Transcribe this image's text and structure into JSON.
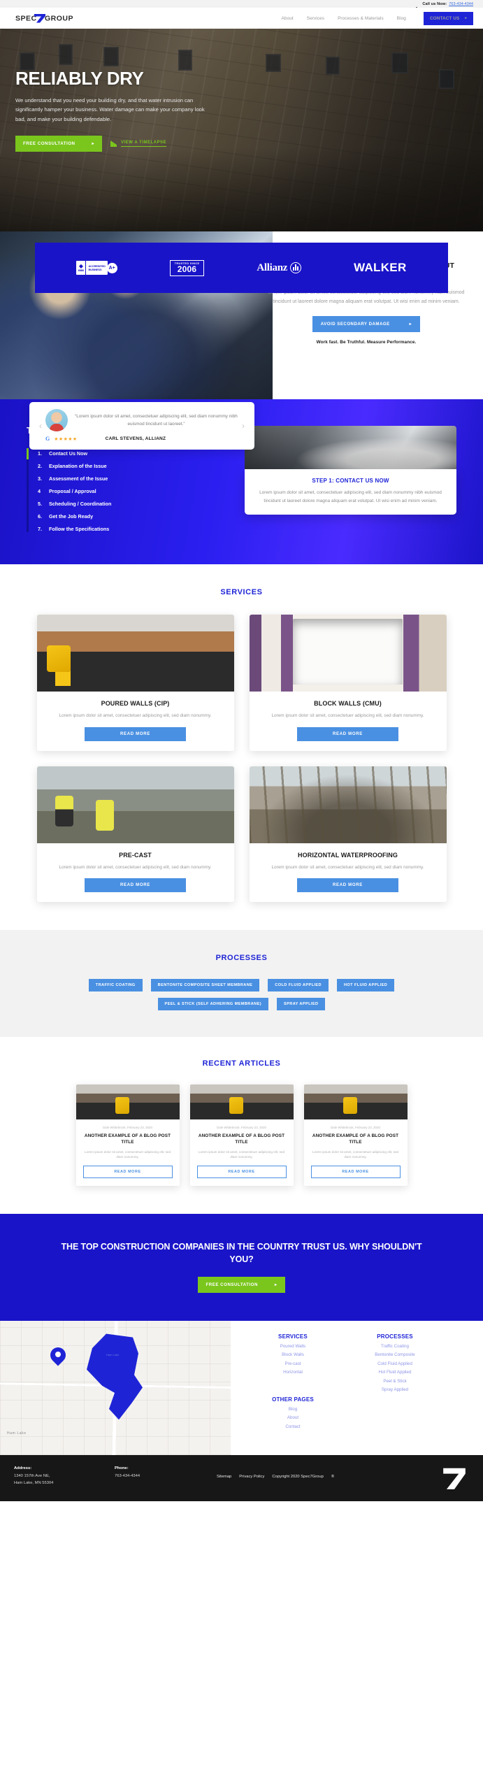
{
  "topbar": {
    "call_label": "Call us Now:",
    "phone": "763-434-4344",
    "phone_icon": "phone-icon"
  },
  "nav": {
    "logo_text": "SPEC7GROUP",
    "links": [
      {
        "label": "About"
      },
      {
        "label": "Services"
      },
      {
        "label": "Processes & Materials"
      },
      {
        "label": "Blog"
      }
    ],
    "contact_label": "CONTACT US",
    "contact_caret": "▸"
  },
  "hero": {
    "title": "RELIABLY DRY",
    "body": "We understand that you need your building dry, and that water intrusion can significantly hamper your business. Water damage can make your company look bad, and make your building defendable.",
    "primary_cta": "FREE CONSULTATION",
    "primary_caret": "▸",
    "secondary_cta": "VIEW A TIMELAPSE"
  },
  "logobar": {
    "bbb": {
      "accredited": "ACCREDITED",
      "business": "BUSINESS",
      "bbb": "BBB",
      "grade": "A+"
    },
    "trusted": {
      "line1": "TRUSTED SINCE",
      "year": "2006"
    },
    "allianz": "Allianz",
    "walker": "WALKER"
  },
  "functioning": {
    "title": "A PROPERLY FUNCTIONING BUILDING WITHOUT COMPLAINTS",
    "body": "Lorem ipsum dolor sit amet, consectetuer adipiscing elit, sed diam nonummy nibh euismod tincidunt ut laoreet dolore magna aliquam erat volutpat. Ut wisi enim ad minim veniam.",
    "cta": "AVOID SECONDARY DAMAGE",
    "cta_caret": "▸",
    "tagline": "Work fast. Be Truthful. Measure Performance."
  },
  "testimonial": {
    "prev": "‹",
    "next": "›",
    "quote": "“Lorem ipsum dolor sit amet, consectetuer adipiscing elit, sed diam nonummy nibh euismod tincidunt ut laoreet.”",
    "google": "G",
    "stars": "★★★★★",
    "author": "CARL STEVENS, ALLIANZ"
  },
  "way": {
    "title": "THE SPEC7GROUP WAY",
    "steps": [
      {
        "n": "1.",
        "label": "Contact Us Now"
      },
      {
        "n": "2.",
        "label": "Explanation of the Issue"
      },
      {
        "n": "3.",
        "label": "Assessment of the Issue"
      },
      {
        "n": "4",
        "label": "Proposal / Approval"
      },
      {
        "n": "5.",
        "label": "Scheduling / Coordination"
      },
      {
        "n": "6.",
        "label": "Get the Job Ready"
      },
      {
        "n": "7.",
        "label": "Follow the Specifications"
      }
    ],
    "card_title": "STEP 1: CONTACT US NOW",
    "card_body": "Lorem ipsum dolor sit amet, consectetuer adipiscing elit, sed diam nonummy nibh euismod tincidunt ut laoreet dolore magna aliquam erat volutpat. Ut wisi enim ad minim veniam."
  },
  "services": {
    "title": "SERVICES",
    "read_more": "READ MORE",
    "items": [
      {
        "title": "POURED WALLS (CIP)",
        "desc": "Lorem ipsum dolor sit amet, consectetuer adipiscing elit, sed diam nonummy."
      },
      {
        "title": "BLOCK WALLS (CMU)",
        "desc": "Lorem ipsum dolor sit amet, consectetuer adipiscing elit, sed diam nonummy."
      },
      {
        "title": "PRE-CAST",
        "desc": "Lorem ipsum dolor sit amet, consectetuer adipiscing elit, sed diam nonummy."
      },
      {
        "title": "HORIZONTAL WATERPROOFING",
        "desc": "Lorem ipsum dolor sit amet, consectetuer adipiscing elit, sed diam nonummy."
      }
    ]
  },
  "processes": {
    "title": "PROCESSES",
    "tags": [
      "TRAFFIC COATING",
      "BENTONITE COMPOSITE SHEET MEMBRANE",
      "COLD FLUID APPLIED",
      "HOT FLUID APPLIED",
      "PEEL & STICK (SELF ADHERING MEMBRANE)",
      "SPRAY APPLIED"
    ]
  },
  "articles": {
    "title": "RECENT ARTICLES",
    "read_more": "READ MORE",
    "items": [
      {
        "date": "Dale Whitebrook, February 23, 2020",
        "title": "ANOTHER EXAMPLE OF A BLOG POST TITLE",
        "desc": "Lorem ipsum dolor sit amet, consectetuer adipiscing elit, sed diam nonummy."
      },
      {
        "date": "Dale Whitebrook, February 23, 2020",
        "title": "ANOTHER EXAMPLE OF A BLOG POST TITLE",
        "desc": "Lorem ipsum dolor sit amet, consectetuer adipiscing elit, sed diam nonummy."
      },
      {
        "date": "Dale Whitebrook, February 23, 2020",
        "title": "ANOTHER EXAMPLE OF A BLOG POST TITLE",
        "desc": "Lorem ipsum dolor sit amet, consectetuer adipiscing elit, sed diam nonummy."
      }
    ]
  },
  "cta": {
    "headline": "THE TOP CONSTRUCTION COMPANIES IN THE COUNTRY TRUST US. WHY SHOULDN'T YOU?",
    "button": "FREE CONSULTATION",
    "caret": "▸"
  },
  "footer": {
    "map_town": "Ham Lake",
    "map_lake_label": "Ham Lake",
    "services_heading": "SERVICES",
    "services_links": [
      "Poured Walls",
      "Block Walls",
      "Pre-cast",
      "Horizontal"
    ],
    "processes_heading": "PROCESSES",
    "processes_links": [
      "Traffic Coating",
      "Bentonite Composite",
      "Cold Fluid Applied",
      "Hot Fluid Applied",
      "Peel & Stick",
      "Spray Applied"
    ],
    "other_heading": "OTHER PAGES",
    "other_links": [
      "Blog",
      "About",
      "Contact"
    ]
  },
  "bottom": {
    "address_label": "Address:",
    "address_line1": "1340 157th Ave NE,",
    "address_line2": "Ham Lake, MN 55304",
    "phone_label": "Phone:",
    "phone_value": "763-434-4344",
    "sitemap": "Sitemap",
    "privacy": "Privacy Policy",
    "copyright": "Copyright 2020 Spec7Group",
    "registered": "®"
  },
  "colors": {
    "brand_blue": "#1914c8",
    "accent_blue": "#4a90e2",
    "green": "#7ac61d",
    "dark": "#171717"
  }
}
